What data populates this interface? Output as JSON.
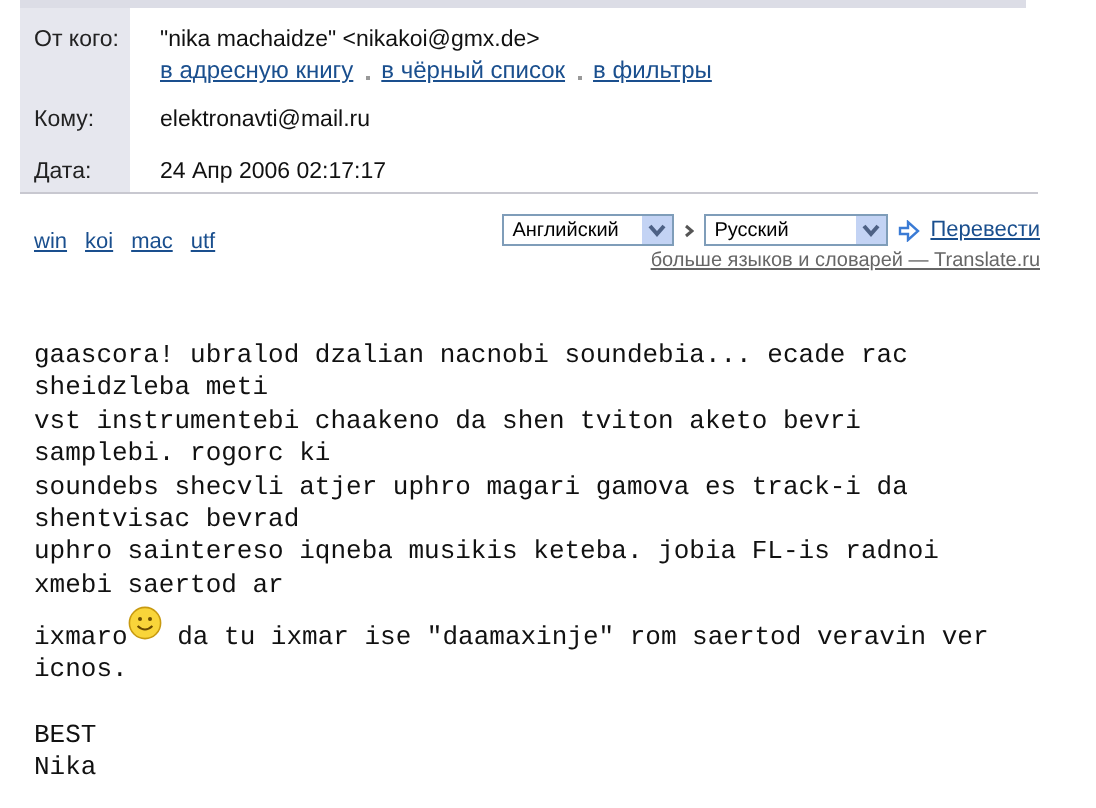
{
  "header": {
    "fields": [
      {
        "kind": "from",
        "label": "От кого:",
        "value": "\"nika machaidze\" <nikakoi@gmx.de>",
        "links": [
          "в адресную книгу",
          "в чёрный список",
          "в фильтры"
        ]
      },
      {
        "kind": "plain",
        "label": "Кому:",
        "value": "elektronavti@mail.ru"
      },
      {
        "kind": "plain",
        "label": "Дата:",
        "value": "24 Апр 2006 02:17:17"
      }
    ]
  },
  "encodings": [
    "win",
    "koi",
    "mac",
    "utf"
  ],
  "translate": {
    "from": "Английский",
    "to": "Русский",
    "button": "Перевести",
    "more": "больше языков и словарей — Translate.ru"
  },
  "body": [
    {
      "kind": "text",
      "text": "gaascora! ubralod dzalian nacnobi soundebia... ecade rac"
    },
    {
      "kind": "text",
      "text": "sheidzleba meti"
    },
    {
      "kind": "text",
      "text": "vst instrumentebi chaakeno da shen tviton aketo bevri"
    },
    {
      "kind": "text",
      "text": "samplebi. rogorc ki"
    },
    {
      "kind": "text",
      "text": "soundebs shecvli atjer uphro magari gamova es track-i da"
    },
    {
      "kind": "text",
      "text": "shentvisac bevrad"
    },
    {
      "kind": "text",
      "text": "uphro saintereso iqneba musikis keteba. jobia FL-is radnoi"
    },
    {
      "kind": "text",
      "text": "xmebi saertod ar"
    },
    {
      "kind": "smiley",
      "before": "ixmaro",
      "after": " da tu ixmar ise \"daamaxinje\" rom saertod veravin ver"
    },
    {
      "kind": "text",
      "text": "icnos."
    },
    {
      "kind": "blank"
    },
    {
      "kind": "text",
      "text": "BEST"
    },
    {
      "kind": "text",
      "text": "Nika"
    }
  ]
}
